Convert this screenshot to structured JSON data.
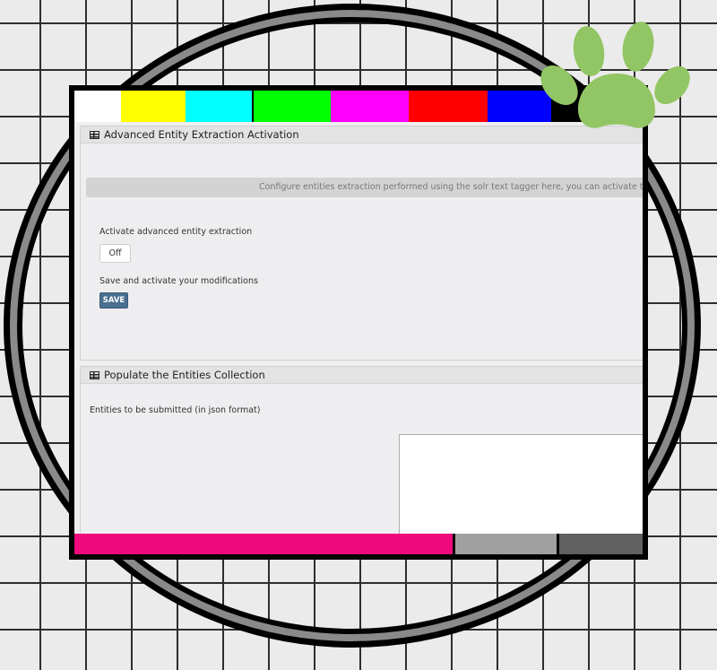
{
  "colors": {
    "top_bars": [
      "#ffffff",
      "#ffff00",
      "#00ffff",
      "#00ff00",
      "#ff00ff",
      "#ff0000",
      "#0000ff",
      "#000000"
    ],
    "bottom_bars": [
      "#ee0a7c",
      "#a0a0a0",
      "#606060"
    ],
    "paw": "#92c564",
    "save_button": "#4a6f8f"
  },
  "panel_entity_extraction": {
    "title": "Advanced Entity Extraction Activation",
    "info_text": "Configure entities extraction performed using the solr text tagger here, you can activate the funct",
    "activate_label": "Activate advanced entity extraction",
    "toggle_value": "Off",
    "save_label": "Save and activate your modifications",
    "save_button": "SAVE"
  },
  "panel_populate": {
    "title": "Populate the Entities Collection",
    "entities_label": "Entities to be submitted (in json format)",
    "entities_value": ""
  },
  "icons": [
    "table-icon",
    "paw-icon"
  ]
}
